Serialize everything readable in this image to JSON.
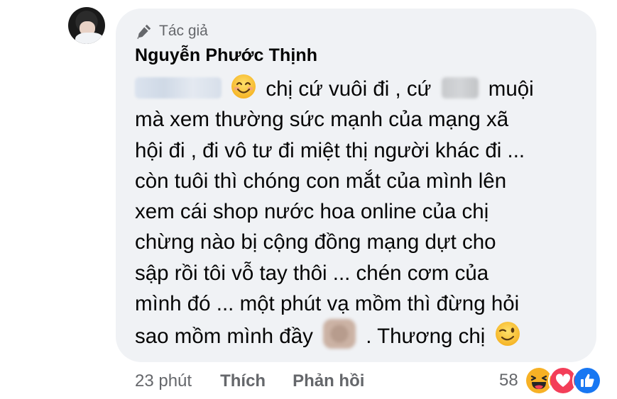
{
  "comment": {
    "badge_label": "Tác giả",
    "author": "Nguyễn Phước Thịnh",
    "lines": [
      "chị cứ vuôi đi , cứ",
      "muội",
      "mà xem thường sức mạnh của mạng xã",
      "hội đi , đi vô tư đi miệt thị người khác đi ...",
      "còn tuôi thì chóng con mắt của mình lên",
      "xem cái shop nước hoa online của chị",
      "chừng nào bị cộng đồng mạng dựt cho",
      "sập rồi tôi vỗ tay thôi ... chén cơm của",
      "mình đó ... một phút vạ mồm thì đừng hỏi",
      "sao mồm mình đầy",
      ". Thương chị"
    ]
  },
  "meta": {
    "time": "23 phút",
    "like_label": "Thích",
    "reply_label": "Phản hồi"
  },
  "reactions": {
    "count": "58",
    "icons": [
      "haha-icon",
      "love-icon",
      "like-icon"
    ]
  },
  "colors": {
    "bubble": "#f0f2f5",
    "meta_text": "#65676b",
    "love": "#f33e58",
    "like": "#1877f2",
    "haha": "#f7b125"
  }
}
